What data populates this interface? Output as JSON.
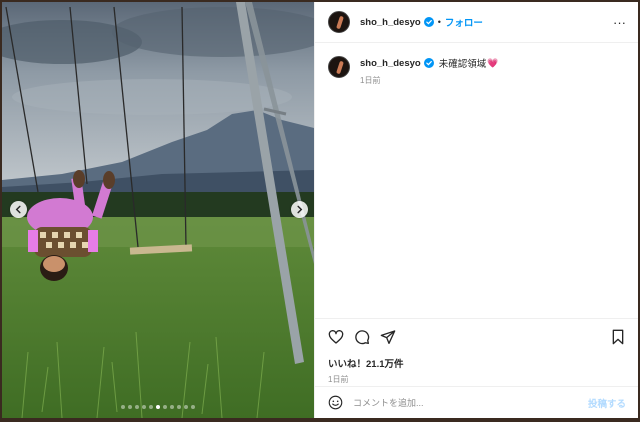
{
  "post": {
    "username": "sho_h_desyo",
    "separator": "•",
    "follow_label": "フォロー",
    "more_label": "···",
    "caption_text": "未確認領域",
    "caption_emoji": "💗",
    "caption_time": "1日前",
    "likes_text": "いいね！21.1万件",
    "post_time": "1日前",
    "comment_placeholder": "コメントを追加...",
    "post_button_label": "投稿する"
  },
  "carousel": {
    "slide_count": 11,
    "active_index": 5
  },
  "icons": {
    "verified": "verified-badge-icon",
    "more": "more-options-icon",
    "like": "heart-outline-icon",
    "comment": "comment-bubble-icon",
    "share": "paper-plane-icon",
    "save": "bookmark-icon",
    "emoji": "smiley-icon",
    "prev": "chevron-left-icon",
    "next": "chevron-right-icon"
  },
  "colors": {
    "link_blue": "#0095f6",
    "post_button_disabled": "#b3dbff",
    "heart_pink": "#e0378d",
    "text_primary": "#262626",
    "text_secondary": "#8e8e8e"
  }
}
